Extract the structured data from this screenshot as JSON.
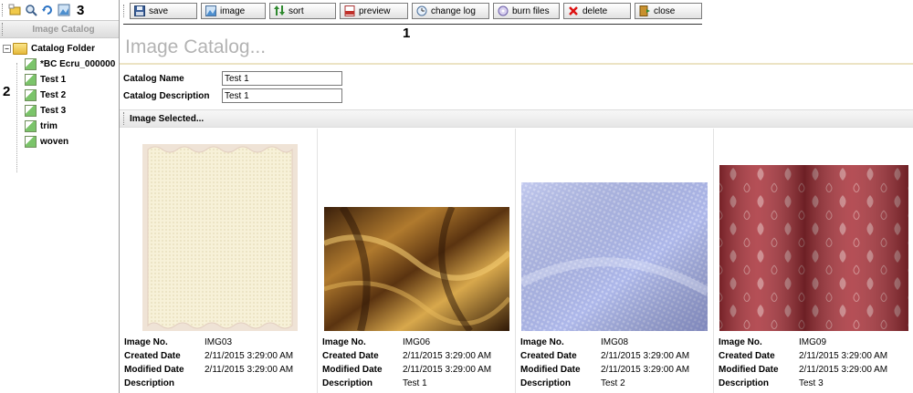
{
  "left_panel": {
    "markers": {
      "n2": "2",
      "n3": "3"
    },
    "header_title": "Image Catalog",
    "root": "Catalog Folder",
    "items": [
      "*BC Ecru_000000",
      "Test 1",
      "Test 2",
      "Test 3",
      "trim",
      "woven"
    ]
  },
  "toolbar": {
    "marker": "1",
    "save": "save",
    "image": "image",
    "sort": "sort",
    "preview": "preview",
    "change_log": "change log",
    "burn_files": "burn files",
    "delete": "delete",
    "close": "close"
  },
  "page_title": "Image Catalog...",
  "form": {
    "name_label": "Catalog Name",
    "name_value": "Test 1",
    "desc_label": "Catalog Description",
    "desc_value": "Test 1"
  },
  "selected_header": "Image Selected...",
  "meta_labels": {
    "image_no": "Image No.",
    "created": "Created Date",
    "modified": "Modified Date",
    "description": "Description"
  },
  "cards": [
    {
      "image_no": "IMG03",
      "created": "2/11/2015 3:29:00 AM",
      "modified": "2/11/2015 3:29:00 AM",
      "description": ""
    },
    {
      "image_no": "IMG06",
      "created": "2/11/2015 3:29:00 AM",
      "modified": "2/11/2015 3:29:00 AM",
      "description": "Test 1"
    },
    {
      "image_no": "IMG08",
      "created": "2/11/2015 3:29:00 AM",
      "modified": "2/11/2015 3:29:00 AM",
      "description": "Test 2"
    },
    {
      "image_no": "IMG09",
      "created": "2/11/2015 3:29:00 AM",
      "modified": "2/11/2015 3:29:00 AM",
      "description": "Test 3"
    }
  ],
  "icons": [
    "new-catalog-icon",
    "search-icon",
    "refresh-icon",
    "image-icon"
  ]
}
